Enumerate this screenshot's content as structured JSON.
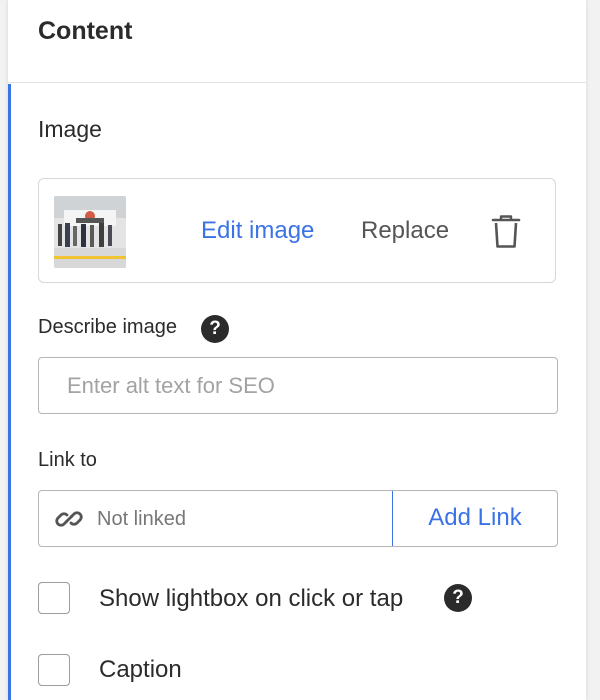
{
  "header": {
    "title": "Content"
  },
  "image_section": {
    "label": "Image",
    "thumbnail_alt": "Uploaded image thumbnail",
    "edit_label": "Edit image",
    "replace_label": "Replace",
    "delete_icon": "trash-icon"
  },
  "describe": {
    "label": "Describe image",
    "help": "?",
    "placeholder": "Enter alt text for SEO",
    "value": ""
  },
  "link": {
    "label": "Link to",
    "icon": "link-icon",
    "status": "Not linked",
    "button": "Add Link"
  },
  "options": {
    "lightbox": {
      "label": "Show lightbox on click or tap",
      "checked": false,
      "help": "?"
    },
    "caption": {
      "label": "Caption",
      "checked": false
    }
  },
  "colors": {
    "accent": "#3b73e6",
    "text": "#2b2b2b",
    "border": "#b5b5b5"
  }
}
